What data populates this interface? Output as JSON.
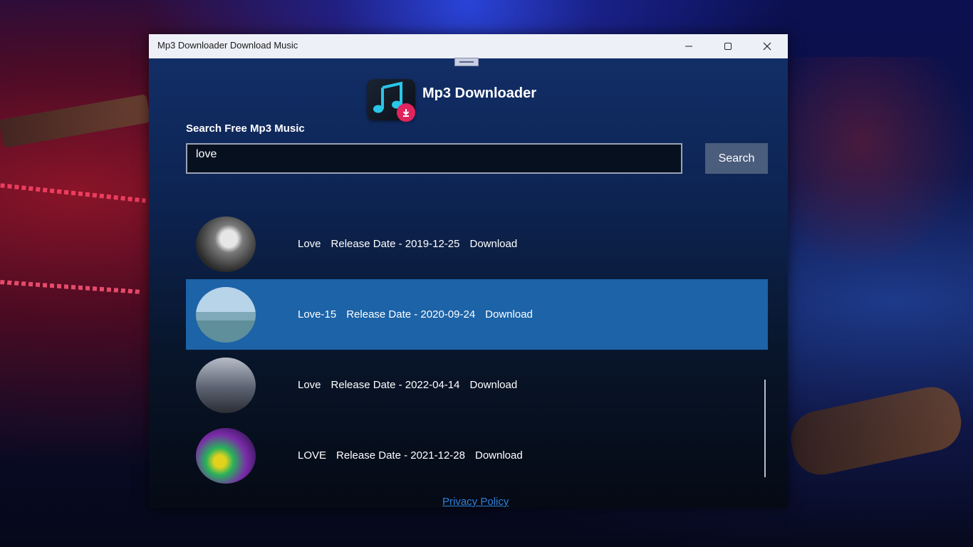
{
  "window": {
    "title": "Mp3 Downloader Download Music",
    "controls": {
      "minimize": "minimize-icon",
      "maximize": "maximize-icon",
      "close": "close-icon"
    }
  },
  "header": {
    "app_name": "Mp3 Downloader",
    "logo_icon": "music-note-icon"
  },
  "search": {
    "label": "Search Free Mp3 Music",
    "value": "love",
    "button_label": "Search"
  },
  "results": [
    {
      "title": "Love",
      "release": "Release Date - 2019-12-25",
      "action": "Download",
      "selected": false
    },
    {
      "title": "Love-15",
      "release": "Release Date - 2020-09-24",
      "action": "Download",
      "selected": true
    },
    {
      "title": "Love",
      "release": "Release Date - 2022-04-14",
      "action": "Download",
      "selected": false
    },
    {
      "title": "LOVE",
      "release": "Release Date - 2021-12-28",
      "action": "Download",
      "selected": false
    }
  ],
  "footer": {
    "privacy_link": "Privacy Policy"
  },
  "colors": {
    "selected_row": "#1c63a8",
    "link": "#2f7fd8",
    "accent_badge": "#e0245e"
  }
}
